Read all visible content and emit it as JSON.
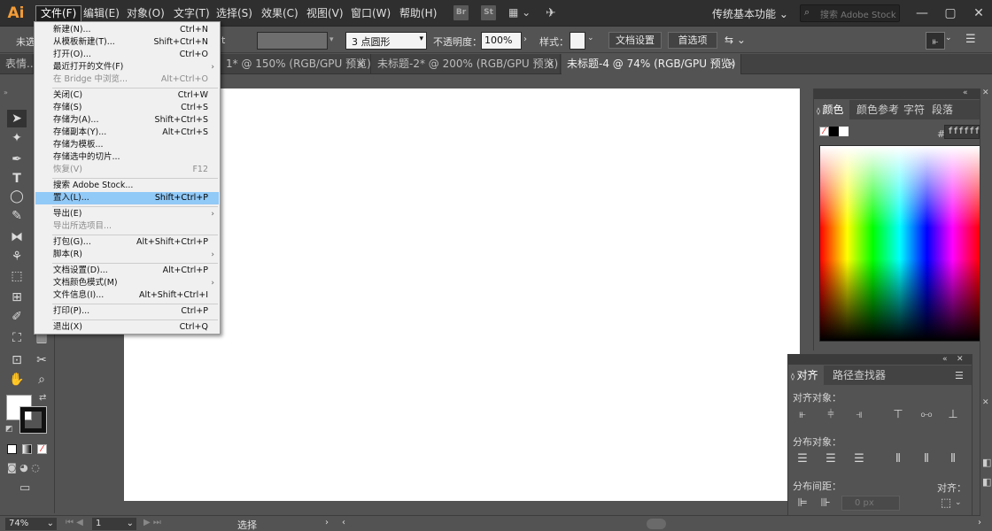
{
  "app": {
    "logo": "Ai",
    "workspace": "传统基本功能",
    "search_placeholder": "搜索 Adobe Stock",
    "bridge_badge": "Br",
    "stock_badge": "St"
  },
  "menubar": {
    "items": [
      "文件(F)",
      "编辑(E)",
      "对象(O)",
      "文字(T)",
      "选择(S)",
      "效果(C)",
      "视图(V)",
      "窗口(W)",
      "帮助(H)"
    ]
  },
  "controlbar": {
    "selection_label": "未选",
    "stroke_unit": "t",
    "brush": "3 点圆形",
    "opacity_label": "不透明度：",
    "opacity_value": "100%",
    "style_label": "样式：",
    "doc_setup": "文档设置",
    "preferences": "首选项"
  },
  "tabs": [
    {
      "label": "表情..."
    },
    {
      "label": "1* @ 150% (RGB/GPU 预览)"
    },
    {
      "label": "未标题-2* @ 200% (RGB/GPU 预览)"
    },
    {
      "label": "未标题-4 @ 74% (RGB/GPU 预览)"
    }
  ],
  "file_menu": {
    "items": [
      {
        "label": "新建(N)...",
        "shortcut": "Ctrl+N"
      },
      {
        "label": "从模板新建(T)...",
        "shortcut": "Shift+Ctrl+N"
      },
      {
        "label": "打开(O)...",
        "shortcut": "Ctrl+O"
      },
      {
        "label": "最近打开的文件(F)",
        "shortcut": ""
      },
      {
        "label": "在 Bridge 中浏览...",
        "shortcut": "Alt+Ctrl+O"
      },
      {
        "label": "关闭(C)",
        "shortcut": "Ctrl+W"
      },
      {
        "label": "存储(S)",
        "shortcut": "Ctrl+S"
      },
      {
        "label": "存储为(A)...",
        "shortcut": "Shift+Ctrl+S"
      },
      {
        "label": "存储副本(Y)...",
        "shortcut": "Alt+Ctrl+S"
      },
      {
        "label": "存储为模板...",
        "shortcut": ""
      },
      {
        "label": "存储选中的切片...",
        "shortcut": ""
      },
      {
        "label": "恢复(V)",
        "shortcut": "F12"
      },
      {
        "label": "搜索 Adobe Stock...",
        "shortcut": ""
      },
      {
        "label": "置入(L)...",
        "shortcut": "Shift+Ctrl+P"
      },
      {
        "label": "导出(E)",
        "shortcut": ""
      },
      {
        "label": "导出所选项目...",
        "shortcut": ""
      },
      {
        "label": "打包(G)...",
        "shortcut": "Alt+Shift+Ctrl+P"
      },
      {
        "label": "脚本(R)",
        "shortcut": ""
      },
      {
        "label": "文档设置(D)...",
        "shortcut": "Alt+Ctrl+P"
      },
      {
        "label": "文档颜色模式(M)",
        "shortcut": ""
      },
      {
        "label": "文件信息(I)...",
        "shortcut": "Alt+Shift+Ctrl+I"
      },
      {
        "label": "打印(P)...",
        "shortcut": "Ctrl+P"
      },
      {
        "label": "退出(X)",
        "shortcut": "Ctrl+Q"
      }
    ],
    "highlighted": "置入(L)..."
  },
  "color_panel": {
    "tabs": [
      "颜色",
      "颜色参考",
      "字符",
      "段落"
    ],
    "hex_label": "#",
    "hex_value": "ffffff"
  },
  "align_panel": {
    "tabs": [
      "对齐",
      "路径查找器"
    ],
    "align_objects": "对齐对象：",
    "distribute_objects": "分布对象：",
    "distribute_spacing": "分布间距：",
    "align_to": "对齐：",
    "spacing_value": "0 px"
  },
  "statusbar": {
    "zoom": "74%",
    "artboard": "1",
    "tool": "选择"
  },
  "colors": {
    "accent": "#f39c37",
    "menu_highlight": "#91c9f7"
  }
}
